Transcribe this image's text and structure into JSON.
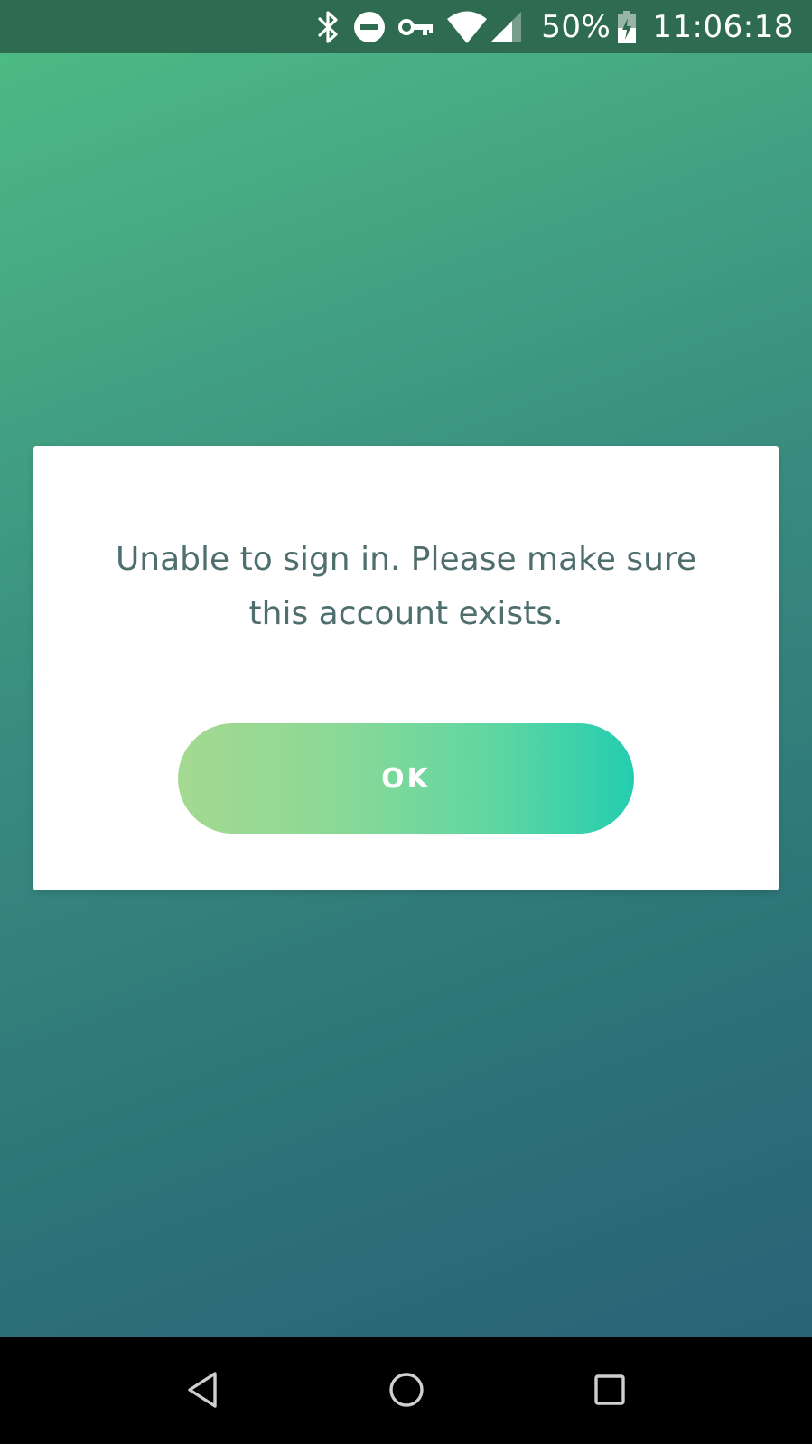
{
  "status_bar": {
    "battery_percent": "50%",
    "time": "11:06:18",
    "icons": [
      "bluetooth-icon",
      "do-not-disturb-icon",
      "vpn-key-icon",
      "wifi-icon",
      "cell-signal-icon",
      "battery-charging-icon"
    ]
  },
  "dialog": {
    "message": "Unable to sign in. Please make sure this account exists.",
    "ok_label": "OK"
  },
  "nav_bar": {
    "icons": [
      "back-icon",
      "home-icon",
      "recents-icon"
    ]
  },
  "colors": {
    "status_bar_bg": "#2e6b50",
    "background_start": "#4fbd85",
    "background_end": "#275f78",
    "message_text": "#4f6e6e",
    "button_gradient_start": "#a5d991",
    "button_gradient_end": "#24cdb0"
  }
}
